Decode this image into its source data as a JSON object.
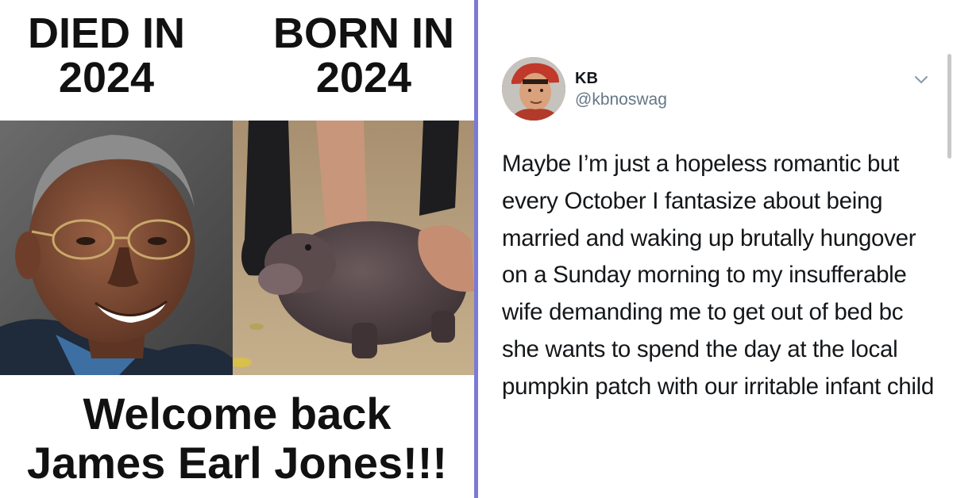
{
  "meme": {
    "left_heading_line1": "DIED IN",
    "left_heading_line2": "2024",
    "right_heading_line1": "BORN IN",
    "right_heading_line2": "2024",
    "caption_line1": "Welcome back",
    "caption_line2": "James Earl Jones!!!"
  },
  "tweet": {
    "display_name": "KB",
    "handle": "@kbnoswag",
    "text": "Maybe I’m just a hopeless romantic but every October I fantasize about being married and waking up brutally hungover on a Sunday morning to my insufferable wife demanding me to get out of bed bc she wants to spend the day at the local pumpkin patch with our irritable infant child",
    "menu_icon": "chevron-down-icon"
  },
  "colors": {
    "divider": "#7b7ad6",
    "handle": "#657786",
    "text": "#14171a"
  }
}
